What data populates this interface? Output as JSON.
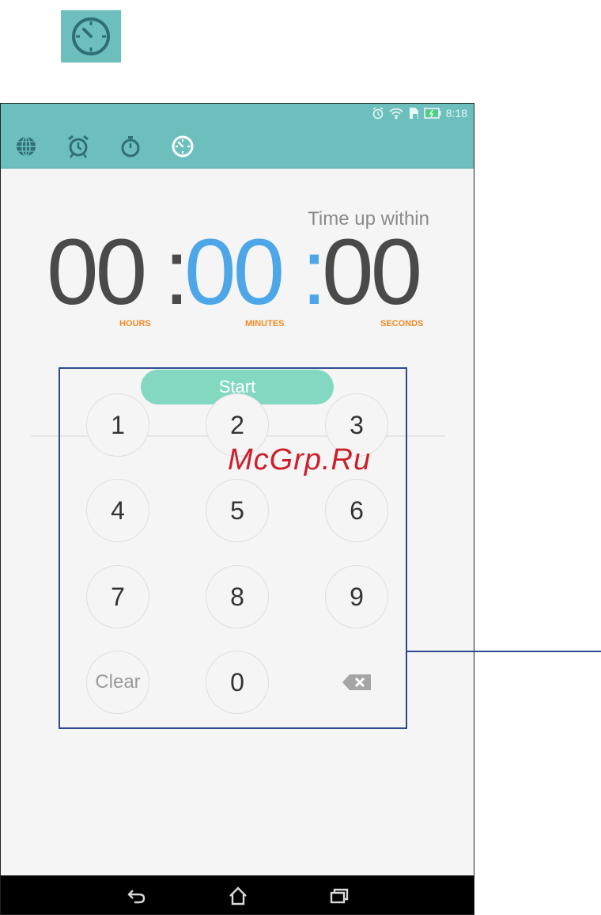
{
  "status_bar": {
    "time": "8:18"
  },
  "timer": {
    "label": "Time up within",
    "hours": "00",
    "minutes": "00",
    "seconds": "00",
    "separator": ":",
    "unit_hours": "HOURS",
    "unit_minutes": "MINUTES",
    "unit_seconds": "SECONDS"
  },
  "actions": {
    "start_label": "Start"
  },
  "keypad": {
    "keys": [
      "1",
      "2",
      "3",
      "4",
      "5",
      "6",
      "7",
      "8",
      "9"
    ],
    "clear": "Clear",
    "zero": "0"
  },
  "watermark": "McGrp.Ru",
  "colors": {
    "accent": "#6cbfbd",
    "start_button": "#83d8c2",
    "minutes": "#4da6e8",
    "units": "#f28a24",
    "digits": "#4a4a4a",
    "callout": "#2e4a8f"
  },
  "icons": {
    "top_icon": "timer-clock-icon",
    "tabs": [
      "world-clock-icon",
      "alarm-icon",
      "stopwatch-icon",
      "timer-icon"
    ],
    "status": [
      "alarm-status-icon",
      "wifi-icon",
      "sim-icon",
      "battery-icon"
    ],
    "nav": [
      "back-icon",
      "home-icon",
      "recent-apps-icon"
    ],
    "backspace": "backspace-icon"
  }
}
